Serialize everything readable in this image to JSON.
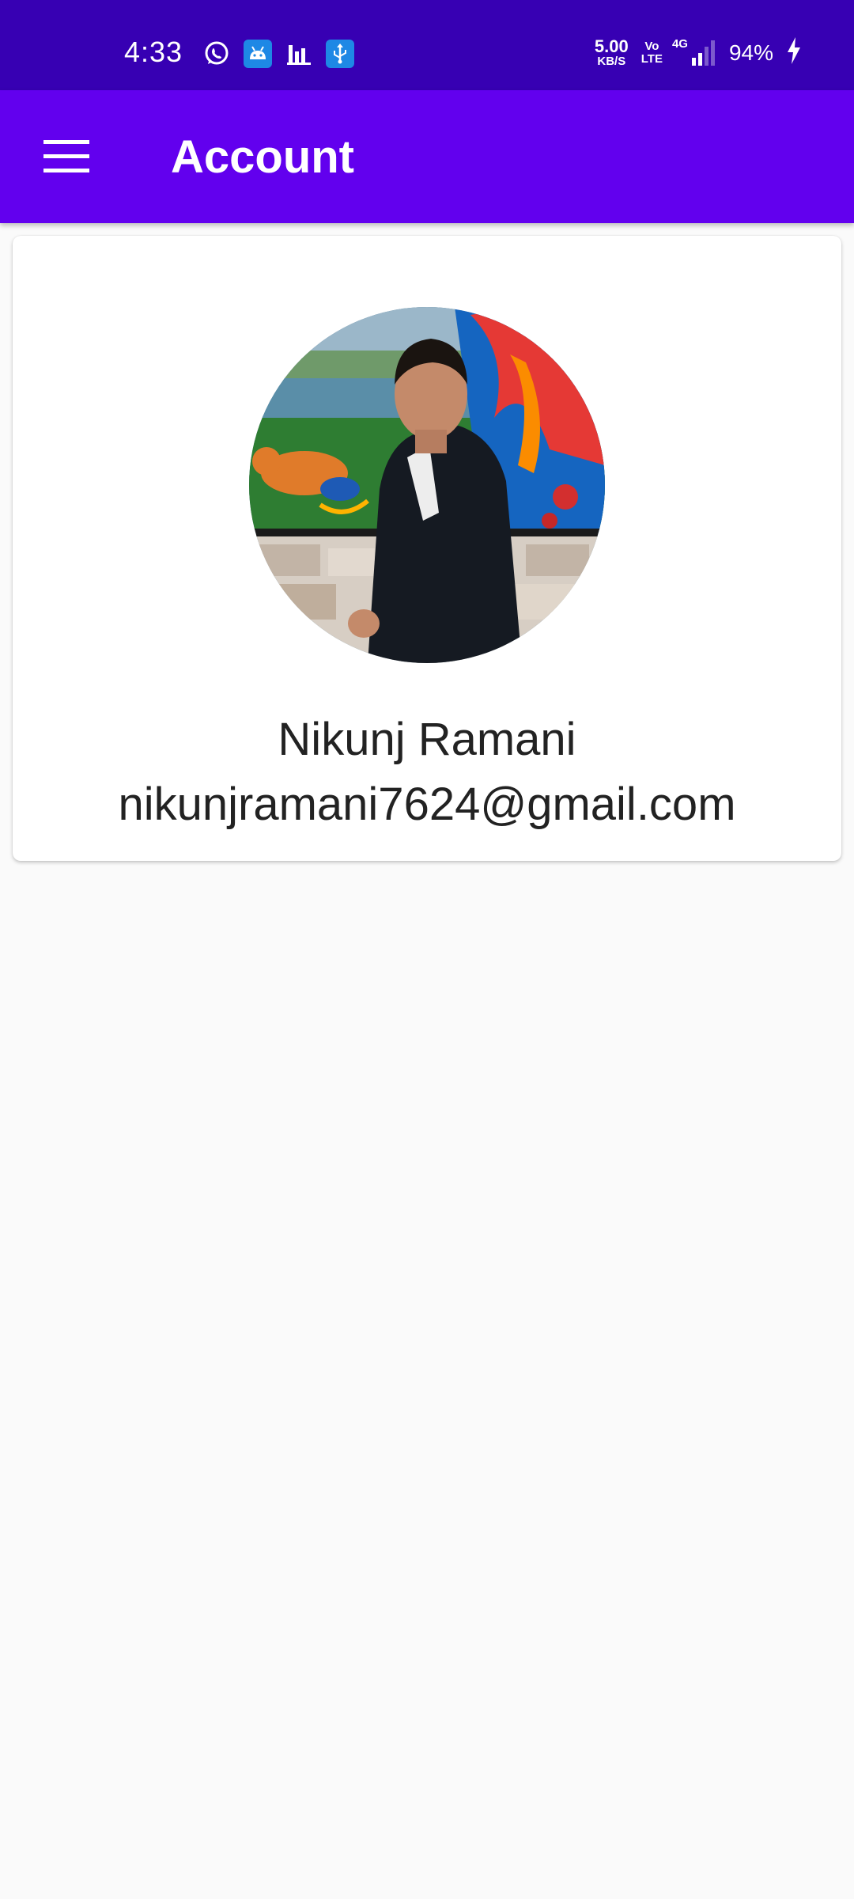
{
  "status_bar": {
    "time": "4:33",
    "net_speed_value": "5.00",
    "net_speed_unit": "KB/S",
    "volte_top": "Vo",
    "volte_bottom": "LTE",
    "network_type": "4G",
    "battery": "94%",
    "notification_icons": [
      "whatsapp-icon",
      "android-icon",
      "bar-chart-icon",
      "usb-icon"
    ],
    "background_color": "#3700b3"
  },
  "app_bar": {
    "title": "Account",
    "menu_icon": "hamburger-menu-icon",
    "background_color": "#6200ee"
  },
  "profile": {
    "name": "Nikunj Ramani",
    "email": "nikunjramani7624@gmail.com"
  }
}
